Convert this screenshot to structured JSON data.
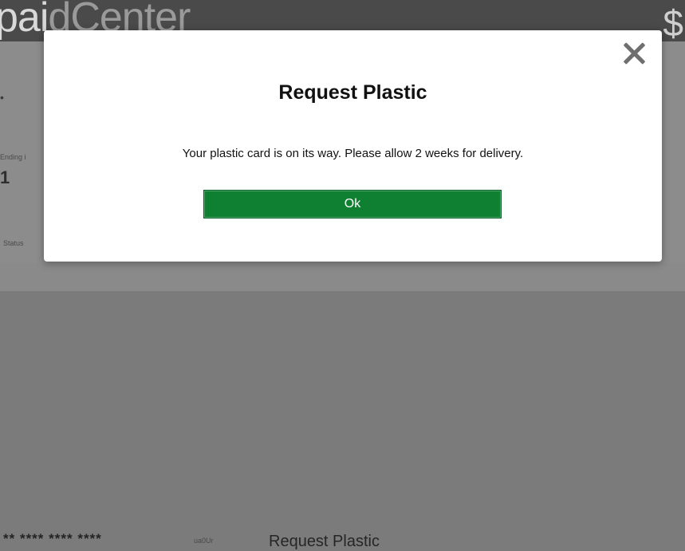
{
  "background": {
    "brand": {
      "dark_part": "pai",
      "light_part": "dCenter"
    },
    "card_number_masked": "** **** **** ****",
    "card_tag": "ua0Ur",
    "request_plastic_link": "Request Plastic"
  },
  "modal": {
    "title": "Request Plastic",
    "message": "Your plastic card is on its way. Please allow 2 weeks for delivery.",
    "ok_label": "Ok",
    "close_icon": "close-icon"
  },
  "colors": {
    "ok_button": "#0f7f32",
    "overlay": "#7b7b7b",
    "modal_bg": "#ffffff"
  }
}
